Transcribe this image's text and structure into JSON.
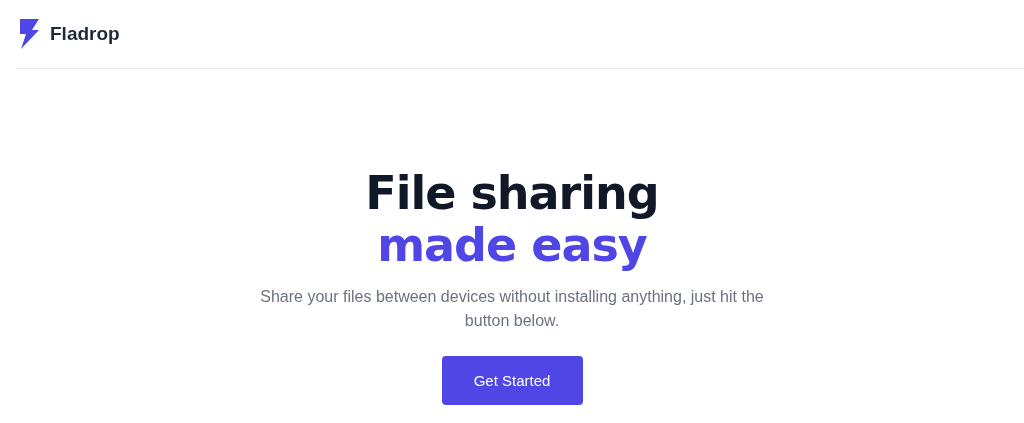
{
  "header": {
    "brand": "Fladrop"
  },
  "hero": {
    "title_line_1": "File sharing",
    "title_line_2": "made easy",
    "description": "Share your files between devices without installing anything, just hit the button below.",
    "button": "Get Started"
  }
}
